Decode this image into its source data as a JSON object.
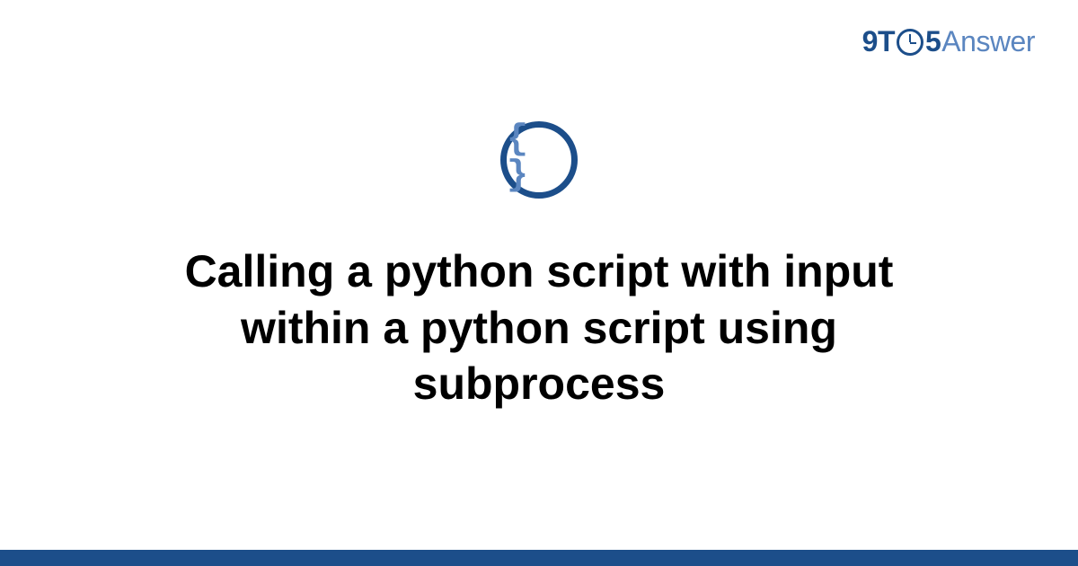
{
  "logo": {
    "part1": "9T",
    "part2": "5",
    "part3": "Answer"
  },
  "icon": {
    "name": "braces-icon",
    "glyph": "{ }"
  },
  "title": "Calling a python script with input within a python script using subprocess",
  "colors": {
    "brand_dark": "#1c4e8a",
    "brand_light": "#5b86c0"
  }
}
